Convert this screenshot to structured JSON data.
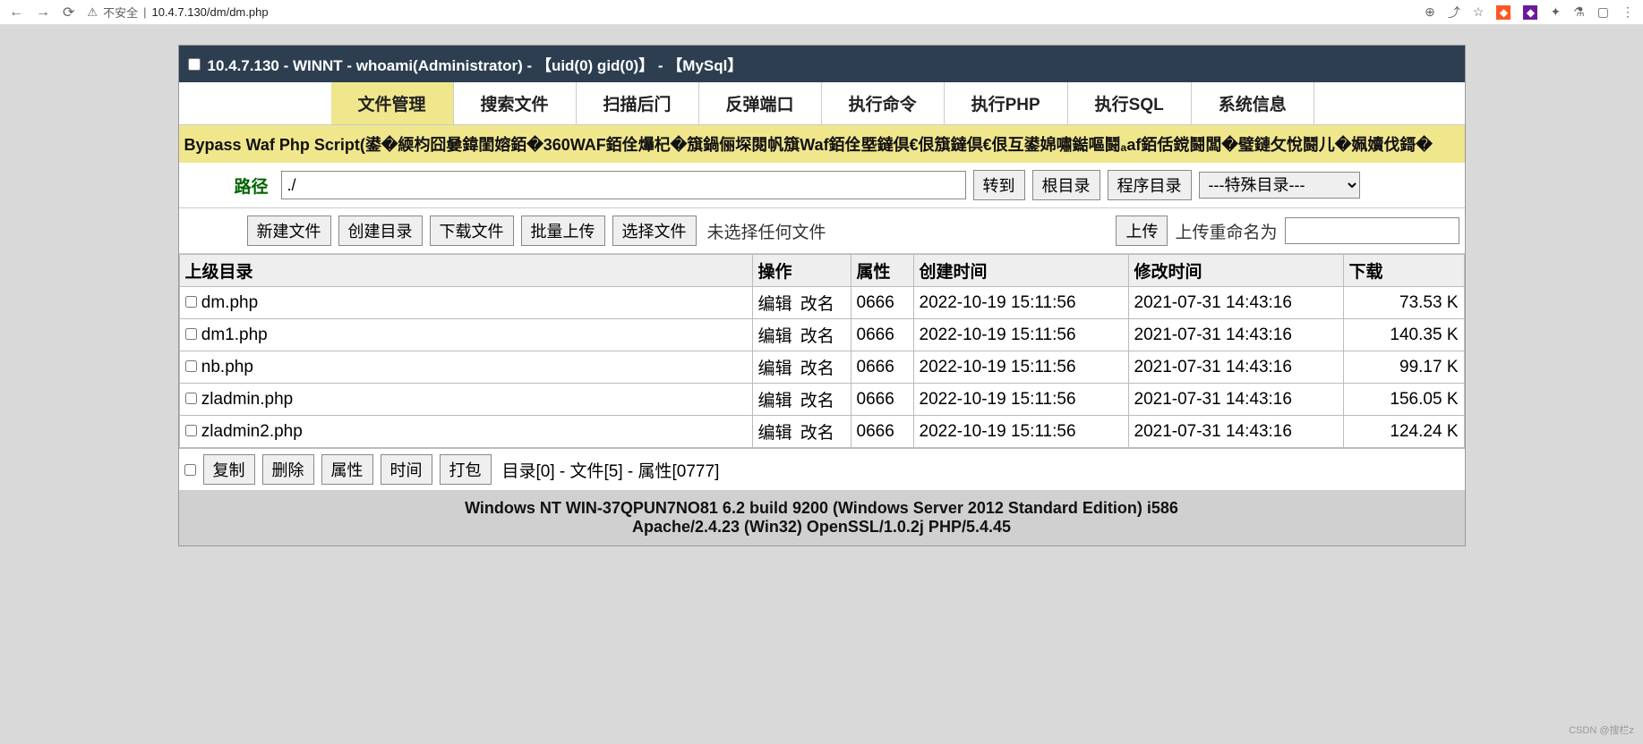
{
  "browser": {
    "insecure_label": "不安全",
    "url": "10.4.7.130/dm/dm.php"
  },
  "title_bar": "10.4.7.130 - WINNT - whoami(Administrator) - 【uid(0) gid(0)】 - 【MySql】",
  "tabs": [
    {
      "label": "文件管理",
      "active": true
    },
    {
      "label": "搜索文件",
      "active": false
    },
    {
      "label": "扫描后门",
      "active": false
    },
    {
      "label": "反弹端口",
      "active": false
    },
    {
      "label": "执行命令",
      "active": false
    },
    {
      "label": "执行PHP",
      "active": false
    },
    {
      "label": "执行SQL",
      "active": false
    },
    {
      "label": "系统信息",
      "active": false
    }
  ],
  "bypass_text": "Bypass Waf Php Script(鍙�緛枃囧嘦鍏閨嫆銆�360WAF銆佺爗杞�簱鍋俪堔閱帆簱Waf銆佺塈鐽倶€佷簱鐽倶€佷互鍙婂嘯鐑嘔鬪ₐaf銆佸鎲鬪闆�璧鏈攵悅鬪儿�姵嬻伐鎶�",
  "path": {
    "label": "路径",
    "value": "./",
    "goto_btn": "转到",
    "root_btn": "根目录",
    "prog_btn": "程序目录",
    "special_select": "---特殊目录---"
  },
  "actions": {
    "new_file": "新建文件",
    "create_dir": "创建目录",
    "download": "下载文件",
    "batch_upload": "批量上传",
    "choose_file": "选择文件",
    "no_file": "未选择任何文件",
    "upload": "上传",
    "upload_rename_label": "上传重命名为"
  },
  "table": {
    "headers": {
      "parent": "上级目录",
      "ops": "操作",
      "attr": "属性",
      "ctime": "创建时间",
      "mtime": "修改时间",
      "download": "下载"
    },
    "op_edit": "编辑",
    "op_rename": "改名",
    "rows": [
      {
        "name": "dm.php",
        "attr": "0666",
        "ctime": "2022-10-19 15:11:56",
        "mtime": "2021-07-31 14:43:16",
        "size": "73.53 K"
      },
      {
        "name": "dm1.php",
        "attr": "0666",
        "ctime": "2022-10-19 15:11:56",
        "mtime": "2021-07-31 14:43:16",
        "size": "140.35 K"
      },
      {
        "name": "nb.php",
        "attr": "0666",
        "ctime": "2022-10-19 15:11:56",
        "mtime": "2021-07-31 14:43:16",
        "size": "99.17 K"
      },
      {
        "name": "zladmin.php",
        "attr": "0666",
        "ctime": "2022-10-19 15:11:56",
        "mtime": "2021-07-31 14:43:16",
        "size": "156.05 K"
      },
      {
        "name": "zladmin2.php",
        "attr": "0666",
        "ctime": "2022-10-19 15:11:56",
        "mtime": "2021-07-31 14:43:16",
        "size": "124.24 K"
      }
    ]
  },
  "footer": {
    "copy": "复制",
    "delete": "删除",
    "attr": "属性",
    "time": "时间",
    "pack": "打包",
    "summary": "目录[0] - 文件[5] - 属性[0777]"
  },
  "sysinfo": {
    "line1": "Windows NT WIN-37QPUN7NO81 6.2 build 9200 (Windows Server 2012 Standard Edition) i586",
    "line2": "Apache/2.4.23 (Win32) OpenSSL/1.0.2j PHP/5.4.45"
  },
  "watermark": "CSDN @搜栏z"
}
